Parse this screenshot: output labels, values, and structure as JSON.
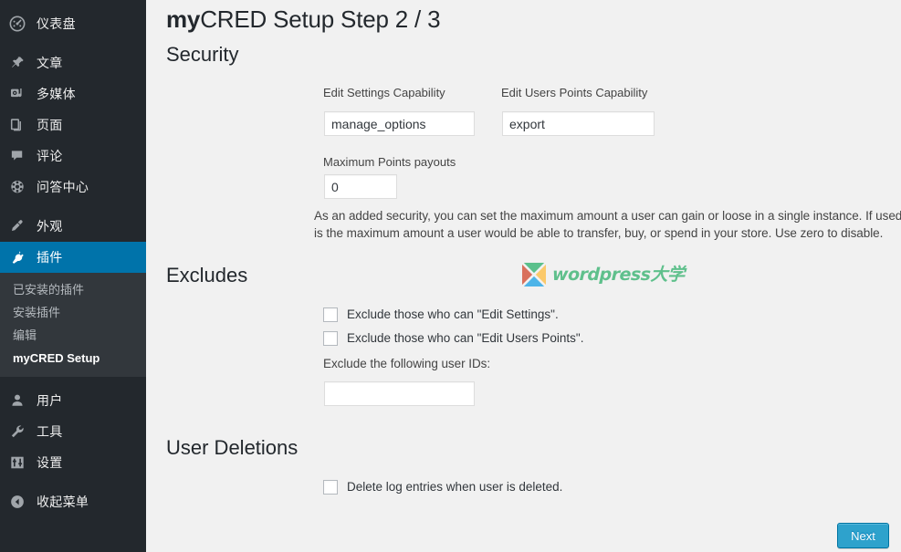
{
  "sidebar": {
    "items": [
      {
        "label": "仪表盘",
        "icon": "dashboard-icon",
        "name": "dashboard",
        "active": false
      },
      {
        "label": "文章",
        "icon": "pin-icon",
        "name": "posts",
        "active": false
      },
      {
        "label": "多媒体",
        "icon": "media-icon",
        "name": "media",
        "active": false
      },
      {
        "label": "页面",
        "icon": "page-icon",
        "name": "pages",
        "active": false
      },
      {
        "label": "评论",
        "icon": "comment-icon",
        "name": "comments",
        "active": false
      },
      {
        "label": "问答中心",
        "icon": "qa-icon",
        "name": "qa-center",
        "active": false
      },
      {
        "label": "外观",
        "icon": "brush-icon",
        "name": "appearance",
        "active": false
      },
      {
        "label": "插件",
        "icon": "plugin-icon",
        "name": "plugins",
        "active": true
      },
      {
        "label": "用户",
        "icon": "user-icon",
        "name": "users",
        "active": false
      },
      {
        "label": "工具",
        "icon": "wrench-icon",
        "name": "tools",
        "active": false
      },
      {
        "label": "设置",
        "icon": "sliders-icon",
        "name": "settings",
        "active": false
      },
      {
        "label": "收起菜单",
        "icon": "collapse-icon",
        "name": "collapse",
        "active": false
      }
    ],
    "submenu": [
      {
        "label": "已安装的插件",
        "name": "installed-plugins",
        "current": false
      },
      {
        "label": "安装插件",
        "name": "add-plugin",
        "current": false
      },
      {
        "label": "编辑",
        "name": "plugin-editor",
        "current": false
      },
      {
        "label": "myCRED Setup",
        "name": "mycred-setup",
        "current": true
      }
    ]
  },
  "page": {
    "title_bold": "my",
    "title_rest": "CRED Setup Step 2 / 3",
    "step_current": 2,
    "step_total": 3
  },
  "security": {
    "heading": "Security",
    "edit_settings_capability": {
      "label": "Edit Settings Capability",
      "value": "manage_options",
      "placeholder": ""
    },
    "edit_users_points_capability": {
      "label": "Edit Users Points Capability",
      "value": "export",
      "placeholder": ""
    },
    "max_payouts": {
      "label": "Maximum Points payouts",
      "value": "0",
      "placeholder": ""
    },
    "help_line_1": "As an added security, you can set the maximum amount a user can gain or loose in a single instance. If used, make sure this",
    "help_line_2": "is the maximum amount a user would be able to transfer, buy, or spend in your store. Use zero to disable."
  },
  "excludes": {
    "heading": "Excludes",
    "checkboxes": [
      {
        "label": "Exclude those who can \"Edit Settings\".",
        "checked": false,
        "name": "exclude-edit-settings"
      },
      {
        "label": "Exclude those who can \"Edit Users Points\".",
        "checked": false,
        "name": "exclude-edit-users-points"
      }
    ],
    "user_ids": {
      "label": "Exclude the following user IDs:",
      "value": "",
      "placeholder": ""
    }
  },
  "user_deletions": {
    "heading": "User Deletions",
    "checkbox": {
      "label": "Delete log entries when user is deleted.",
      "checked": false
    }
  },
  "watermark": {
    "text": "wordpress大学",
    "colors": {
      "top": "#5bc08c",
      "right": "#fbc96a",
      "bottom": "#4db4e8",
      "left": "#d9705c",
      "text": "#5fc08c"
    }
  },
  "footer": {
    "next_label": "Next"
  },
  "theme": {
    "sidebar_bg": "#23282d",
    "submenu_bg": "#32373c",
    "accent": "#0073aa",
    "button_bg": "#2ea2cc",
    "content_bg": "#f1f1f1"
  }
}
